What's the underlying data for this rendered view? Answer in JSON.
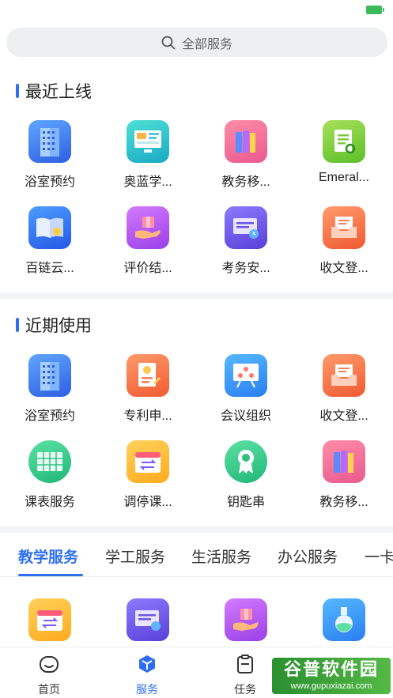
{
  "status": {
    "battery_label": ""
  },
  "search": {
    "placeholder": "全部服务"
  },
  "recent_online": {
    "title": "最近上线",
    "items": [
      {
        "label": "浴室预约",
        "icon": "building-icon"
      },
      {
        "label": "奥蓝学...",
        "icon": "monitor-icon"
      },
      {
        "label": "教务移...",
        "icon": "books-icon"
      },
      {
        "label": "Emeral...",
        "icon": "document-search-icon"
      },
      {
        "label": "百链云...",
        "icon": "open-book-icon"
      },
      {
        "label": "评价结...",
        "icon": "hand-box-icon"
      },
      {
        "label": "考务安...",
        "icon": "schedule-board-icon"
      },
      {
        "label": "收文登...",
        "icon": "inbox-icon"
      }
    ]
  },
  "recent_used": {
    "title": "近期使用",
    "items": [
      {
        "label": "浴室预约",
        "icon": "building-icon"
      },
      {
        "label": "专利申...",
        "icon": "patent-icon"
      },
      {
        "label": "会议组织",
        "icon": "meeting-board-icon"
      },
      {
        "label": "收文登...",
        "icon": "inbox-icon"
      },
      {
        "label": "课表服务",
        "icon": "timetable-icon"
      },
      {
        "label": "调停课...",
        "icon": "calendar-swap-icon"
      },
      {
        "label": "钥匙串",
        "icon": "award-badge-icon"
      },
      {
        "label": "教务移...",
        "icon": "books-icon"
      }
    ]
  },
  "category_tabs": [
    "教学服务",
    "学工服务",
    "生活服务",
    "办公服务",
    "一卡"
  ],
  "teaching_items": [
    {
      "icon": "calendar-swap-icon"
    },
    {
      "icon": "schedule-board-icon"
    },
    {
      "icon": "hand-box-icon"
    },
    {
      "icon": "flask-icon"
    }
  ],
  "bottom_nav": [
    {
      "label": "首页",
      "icon": "home-icon"
    },
    {
      "label": "服务",
      "icon": "cube-icon"
    },
    {
      "label": "任务",
      "icon": "clipboard-icon"
    }
  ],
  "watermark": {
    "main": "谷普软件园",
    "sub": "www.gupuxiazai.com"
  },
  "colors": {
    "accent": "#2e6ff2",
    "divider": "#f2f3f5"
  }
}
